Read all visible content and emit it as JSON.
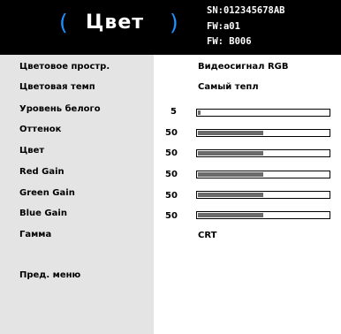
{
  "header": {
    "title": "Цвет",
    "bracket_left": "(",
    "bracket_right": ")",
    "info_lines": [
      "SN:012345678AB",
      "FW:a01",
      "FW: B006"
    ]
  },
  "menu": {
    "items": [
      {
        "label": "Цветовое простр.",
        "value_text": "Видеосигнал RGB"
      },
      {
        "label": "Цветовая темп",
        "value_text": "Самый тепл"
      },
      {
        "label": "Уровень белого",
        "number": "5",
        "level": 0.02
      },
      {
        "label": "Оттенок",
        "number": "50",
        "level": 0.5
      },
      {
        "label": "Цвет",
        "number": "50",
        "level": 0.5
      },
      {
        "label": "Red Gain",
        "number": "50",
        "level": 0.5
      },
      {
        "label": "Green Gain",
        "number": "50",
        "level": 0.5
      },
      {
        "label": "Blue Gain",
        "number": "50",
        "level": 0.5
      },
      {
        "label": "Гамма",
        "value_text": "CRT"
      }
    ],
    "prev_menu": "Пред. меню"
  },
  "colors": {
    "header_bg": "#000000",
    "bracket": "#1e90ff",
    "left_panel": "#e4e4e4",
    "bar_fill": "#6a6a6a"
  }
}
